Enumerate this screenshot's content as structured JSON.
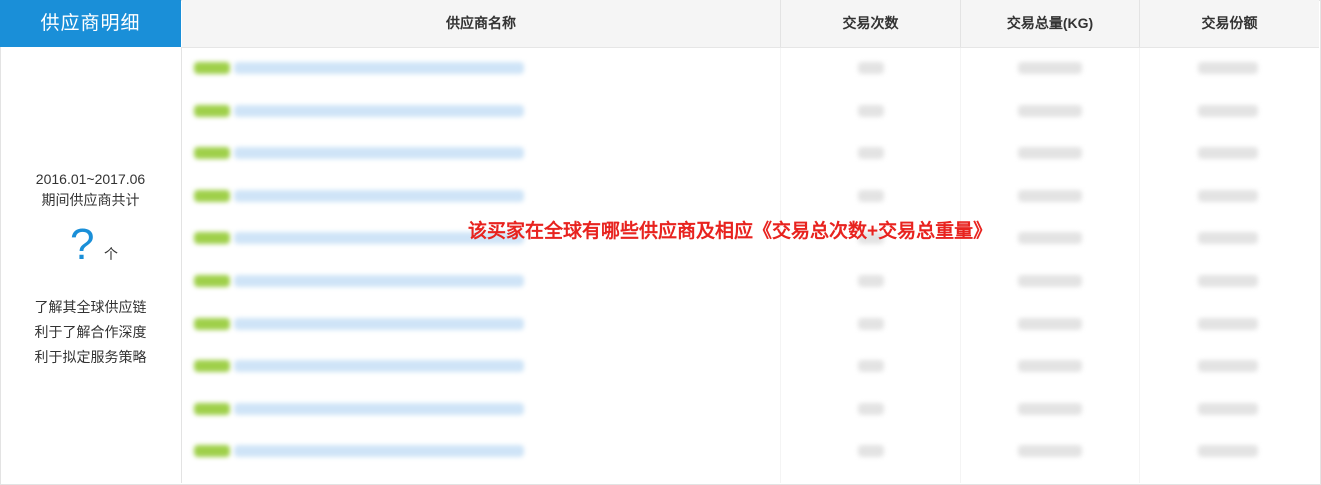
{
  "sidebar": {
    "title": "供应商明细",
    "period": "2016.01~2017.06",
    "period_caption": "期间供应商共计",
    "unknown_count": "?",
    "count_unit": "个",
    "notes": [
      "了解其全球供应链",
      "利于了解合作深度",
      "利于拟定服务策略"
    ]
  },
  "table": {
    "columns": [
      "供应商名称",
      "交易次数",
      "交易总量(KG)",
      "交易份额"
    ],
    "row_count": 10
  },
  "overlay": {
    "caption": "该买家在全球有哪些供应商及相应《交易总次数+交易总重量》"
  },
  "colors": {
    "accent": "#1a8fd8",
    "tag_green": "#9fd04a",
    "caption_red": "#e8231f"
  }
}
